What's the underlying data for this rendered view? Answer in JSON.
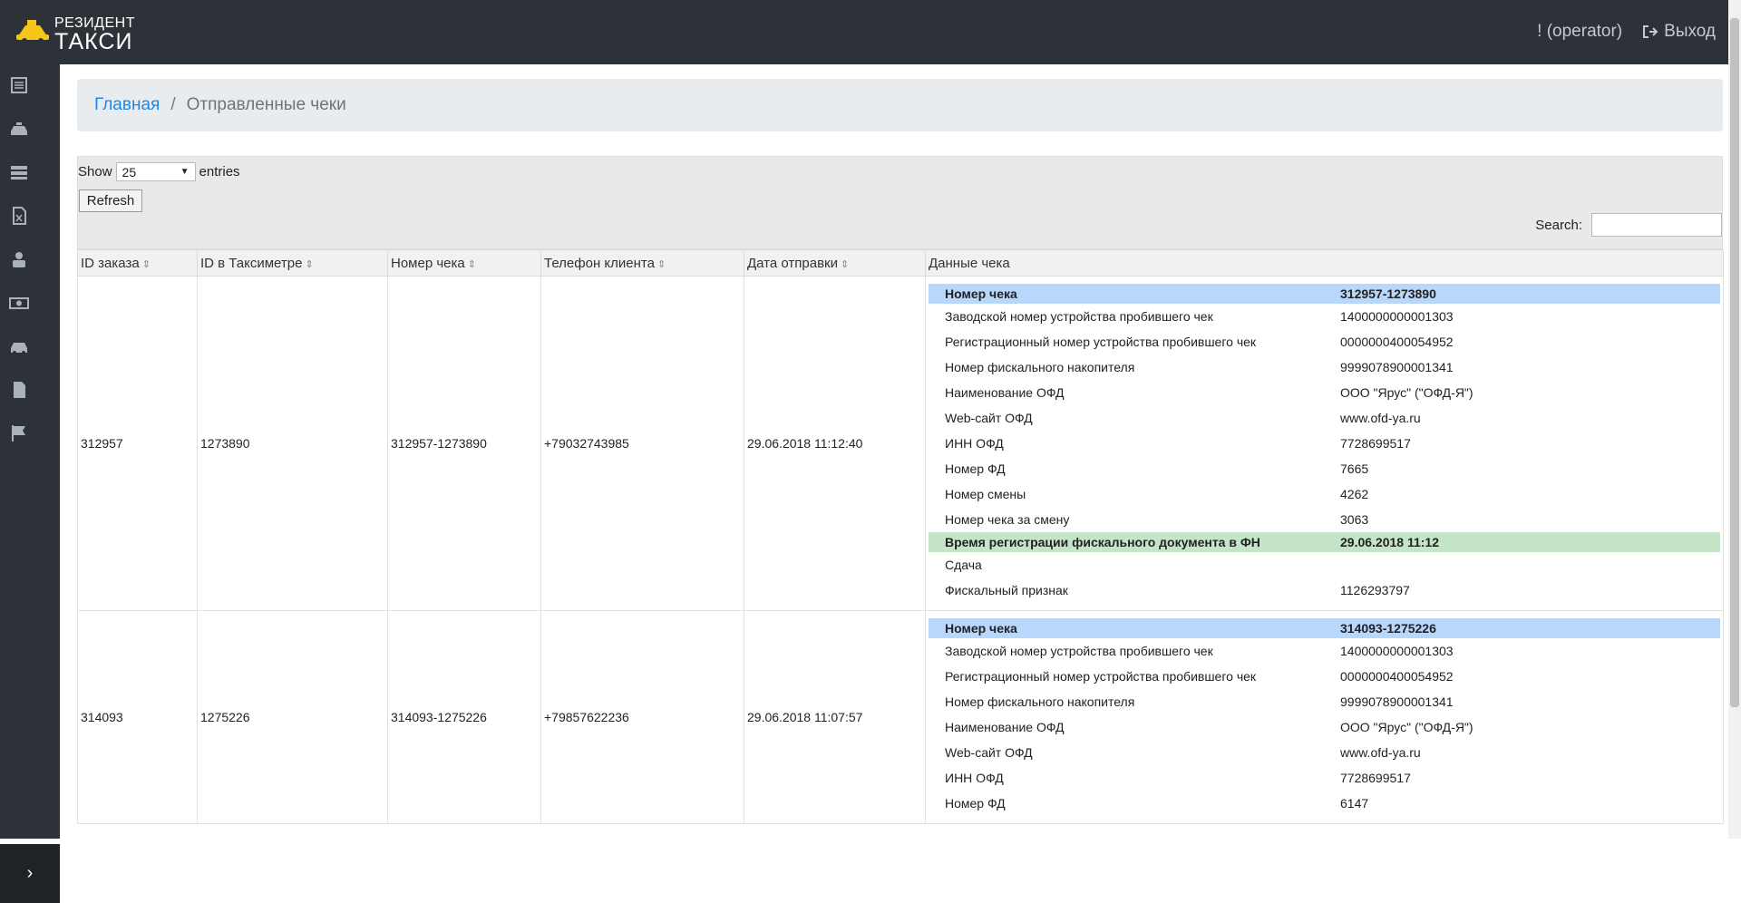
{
  "header": {
    "logo_line1": "РЕЗИДЕНТ",
    "logo_line2": "ТАКСИ",
    "user": "! (operator)",
    "logout": "Выход"
  },
  "sidebar": {
    "icons": [
      "list-icon",
      "taxi-icon",
      "servers-icon",
      "excel-file-icon",
      "driver-icon",
      "money-icon",
      "car-icon",
      "document-icon",
      "flag-icon"
    ],
    "toggle": "›"
  },
  "breadcrumb": {
    "home": "Главная",
    "separator": "/",
    "current": "Отправленные чеки"
  },
  "controls": {
    "show_label": "Show",
    "entries_value": "25",
    "entries_label": "entries",
    "refresh": "Refresh",
    "search_label": "Search:"
  },
  "table": {
    "columns": [
      "ID заказа",
      "ID в Таксиметре",
      "Номер чека",
      "Телефон клиента",
      "Дата отправки",
      "Данные чека"
    ],
    "rows": [
      {
        "order_id": "312957",
        "taximeter_id": "1273890",
        "receipt_no": "312957-1273890",
        "phone": "+79032743985",
        "sent_date": "29.06.2018 11:12:40",
        "details": [
          {
            "k": "Номер чека",
            "v": "312957-1273890"
          },
          {
            "k": "Заводской номер устройства пробившего чек",
            "v": "1400000000001303"
          },
          {
            "k": "Регистрационный номер устройства пробившего чек",
            "v": "0000000400054952"
          },
          {
            "k": "Номер фискального накопителя",
            "v": "9999078900001341"
          },
          {
            "k": "Наименование ОФД",
            "v": "ООО \"Ярус\" (\"ОФД-Я\")"
          },
          {
            "k": "Web-сайт ОФД",
            "v": "www.ofd-ya.ru"
          },
          {
            "k": "ИНН ОФД",
            "v": "7728699517"
          },
          {
            "k": "Номер ФД",
            "v": "7665"
          },
          {
            "k": "Номер смены",
            "v": "4262"
          },
          {
            "k": "Номер чека за смену",
            "v": "3063"
          },
          {
            "k": "Время регистрации фискального документа в ФН",
            "v": "29.06.2018 11:12"
          },
          {
            "k": "Сдача",
            "v": ""
          },
          {
            "k": "Фискальный признак",
            "v": "1126293797"
          }
        ]
      },
      {
        "order_id": "314093",
        "taximeter_id": "1275226",
        "receipt_no": "314093-1275226",
        "phone": "+79857622236",
        "sent_date": "29.06.2018 11:07:57",
        "details": [
          {
            "k": "Номер чека",
            "v": "314093-1275226"
          },
          {
            "k": "Заводской номер устройства пробившего чек",
            "v": "1400000000001303"
          },
          {
            "k": "Регистрационный номер устройства пробившего чек",
            "v": "0000000400054952"
          },
          {
            "k": "Номер фискального накопителя",
            "v": "9999078900001341"
          },
          {
            "k": "Наименование ОФД",
            "v": "ООО \"Ярус\" (\"ОФД-Я\")"
          },
          {
            "k": "Web-сайт ОФД",
            "v": "www.ofd-ya.ru"
          },
          {
            "k": "ИНН ОФД",
            "v": "7728699517"
          },
          {
            "k": "Номер ФД",
            "v": "6147"
          }
        ]
      }
    ]
  }
}
